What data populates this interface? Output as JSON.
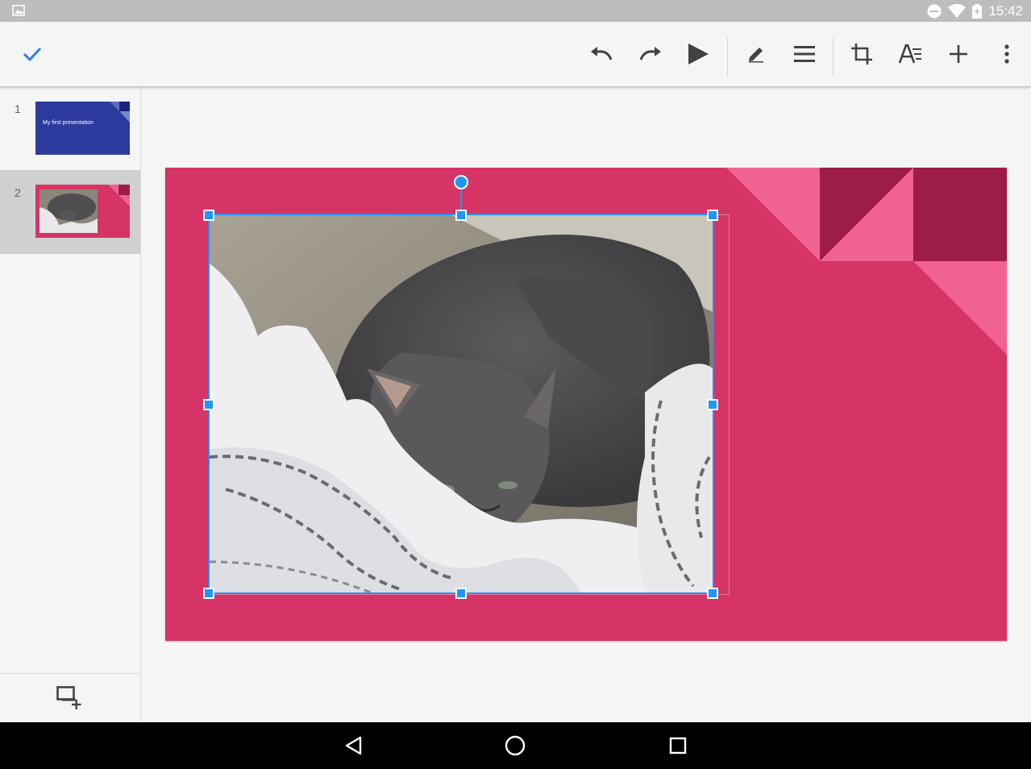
{
  "status_bar": {
    "time": "15:42",
    "icons": [
      "gallery-notification-icon",
      "do-not-disturb-icon",
      "wifi-icon",
      "battery-icon"
    ]
  },
  "toolbar": {
    "done_icon": "checkmark-icon",
    "actions": [
      "undo-icon",
      "redo-icon",
      "present-icon",
      "edit-icon",
      "format-icon",
      "crop-icon",
      "text-format-icon",
      "insert-icon",
      "more-vert-icon"
    ],
    "accent_color": "#2f80ed"
  },
  "sidebar": {
    "slides": [
      {
        "number": "1",
        "title": "My first presentation",
        "theme_color": "#2b3a9c"
      },
      {
        "number": "2",
        "title": "",
        "theme_color": "#d63366",
        "selected": true
      }
    ],
    "add_slide_icon": "add-slide-icon"
  },
  "canvas": {
    "slide_color": "#d63366",
    "accent_light": "#f06292",
    "accent_dark": "#9e1c4a",
    "selection_color": "#2196f3",
    "selected_object": "image"
  },
  "nav_bar": {
    "buttons": [
      "back-icon",
      "home-icon",
      "recents-icon"
    ]
  }
}
